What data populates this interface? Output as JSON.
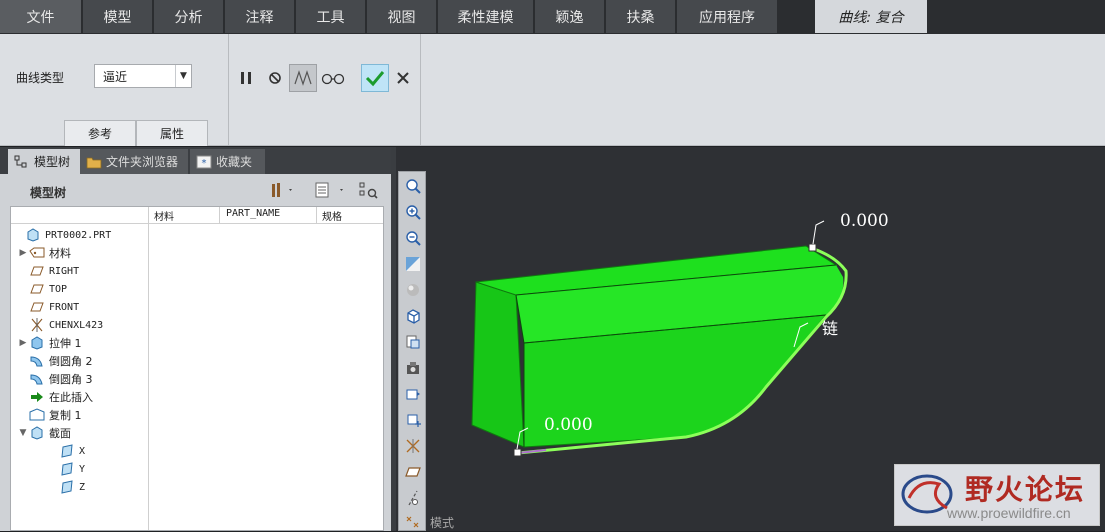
{
  "menu": {
    "tabs": [
      "文件",
      "模型",
      "分析",
      "注释",
      "工具",
      "视图",
      "柔性建模",
      "颖逸",
      "扶桑",
      "应用程序"
    ],
    "active_tab": "曲线: 复合"
  },
  "ribbon": {
    "curve_type_label": "曲线类型",
    "curve_type_value": "逼近",
    "tabs": [
      "参考",
      "属性"
    ]
  },
  "left_panel": {
    "tabs": [
      "模型树",
      "文件夹浏览器",
      "收藏夹"
    ],
    "title": "模型树",
    "columns": [
      "材料",
      "PART_NAME",
      "规格"
    ],
    "tree": [
      {
        "label": "PRT0002.PRT",
        "icon": "part-icon",
        "exp": "",
        "indent": 0
      },
      {
        "label": "材料",
        "icon": "material-icon",
        "exp": "▶",
        "indent": 1
      },
      {
        "label": "RIGHT",
        "icon": "datum-plane-icon",
        "exp": "",
        "indent": 1
      },
      {
        "label": "TOP",
        "icon": "datum-plane-icon",
        "exp": "",
        "indent": 1
      },
      {
        "label": "FRONT",
        "icon": "datum-plane-icon",
        "exp": "",
        "indent": 1
      },
      {
        "label": "CHENXL423",
        "icon": "coordinate-system-icon",
        "exp": "",
        "indent": 1
      },
      {
        "label": "拉伸 1",
        "icon": "extrude-icon",
        "exp": "▶",
        "indent": 1
      },
      {
        "label": "倒圆角 2",
        "icon": "round-icon",
        "exp": "",
        "indent": 1
      },
      {
        "label": "倒圆角 3",
        "icon": "round-icon",
        "exp": "",
        "indent": 1
      },
      {
        "label": "在此插入",
        "icon": "insert-here-icon",
        "exp": "",
        "indent": 1
      },
      {
        "label": "复制 1",
        "icon": "copy-icon",
        "exp": "",
        "indent": 1
      },
      {
        "label": "截面",
        "icon": "section-icon",
        "exp": "▼",
        "indent": 1
      },
      {
        "label": "X",
        "icon": "section-x-icon",
        "exp": "",
        "indent": 2
      },
      {
        "label": "Y",
        "icon": "section-y-icon",
        "exp": "",
        "indent": 2
      },
      {
        "label": "Z",
        "icon": "section-z-icon",
        "exp": "",
        "indent": 2
      }
    ]
  },
  "graphics": {
    "annotation_top": "0.000",
    "annotation_bottom": "0.000",
    "chain_label": "链",
    "mode_text": "模式",
    "part_color": "#1ee01e"
  },
  "watermark": {
    "title": "野火论坛",
    "url": "www.proewildfire.cn"
  }
}
